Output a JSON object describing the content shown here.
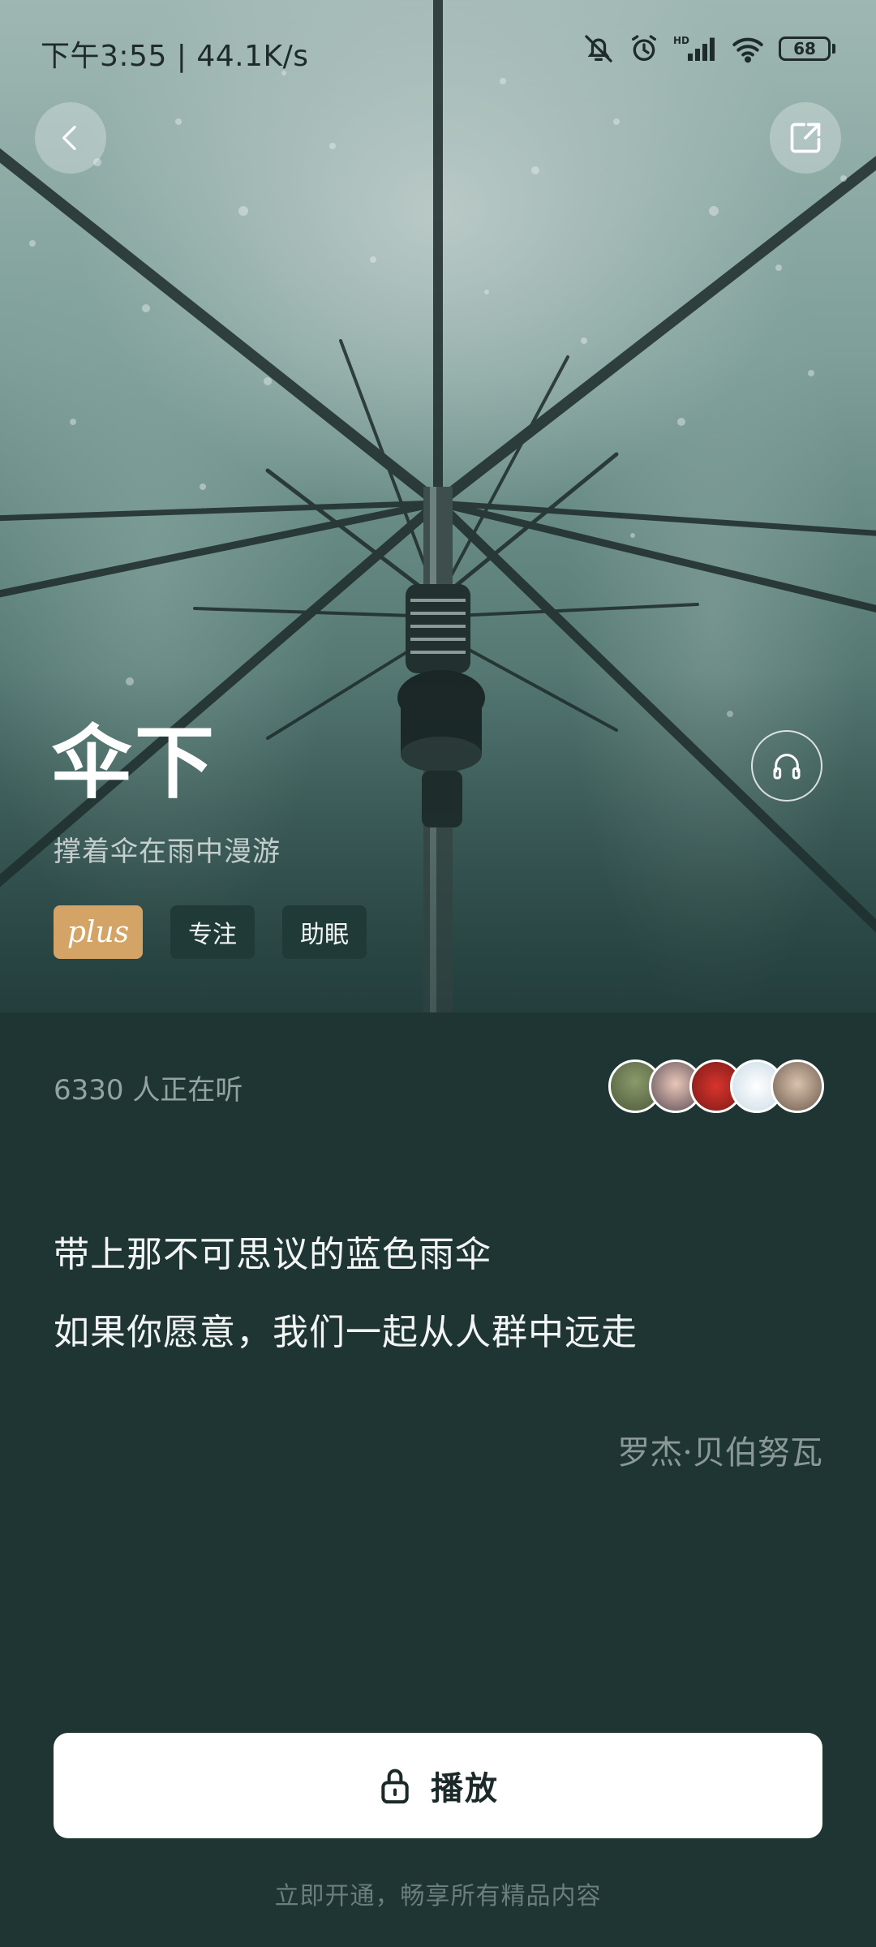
{
  "status_bar": {
    "time_speed": "下午3:55 | 44.1K/s",
    "battery": "68",
    "icons": [
      "mute-bell-icon",
      "alarm-icon",
      "hd-signal-icon",
      "wifi-icon",
      "battery-icon"
    ]
  },
  "nav": {
    "back_icon": "chevron-left-icon",
    "share_icon": "share-icon"
  },
  "hero": {
    "title": "伞下",
    "subtitle": "撑着伞在雨中漫游",
    "headphone_icon": "headphones-icon",
    "tags": [
      {
        "label": "plus"
      },
      {
        "label": "专注"
      },
      {
        "label": "助眠"
      }
    ]
  },
  "listeners": {
    "text": "6330 人正在听",
    "avatars": [
      "avatar-1",
      "avatar-2",
      "avatar-3",
      "avatar-4",
      "avatar-5"
    ]
  },
  "quote": {
    "line1": "带上那不可思议的蓝色雨伞",
    "line2": "如果你愿意，我们一起从人群中远走",
    "author": "罗杰·贝伯努瓦"
  },
  "play": {
    "label": "播放",
    "icon": "lock-icon"
  },
  "promo": "立即开通，畅享所有精品内容",
  "colors": {
    "background": "#1e3534",
    "plus_tag": "#d3a465",
    "tag_bg": "#1f3a37",
    "button_bg": "#ffffff"
  }
}
